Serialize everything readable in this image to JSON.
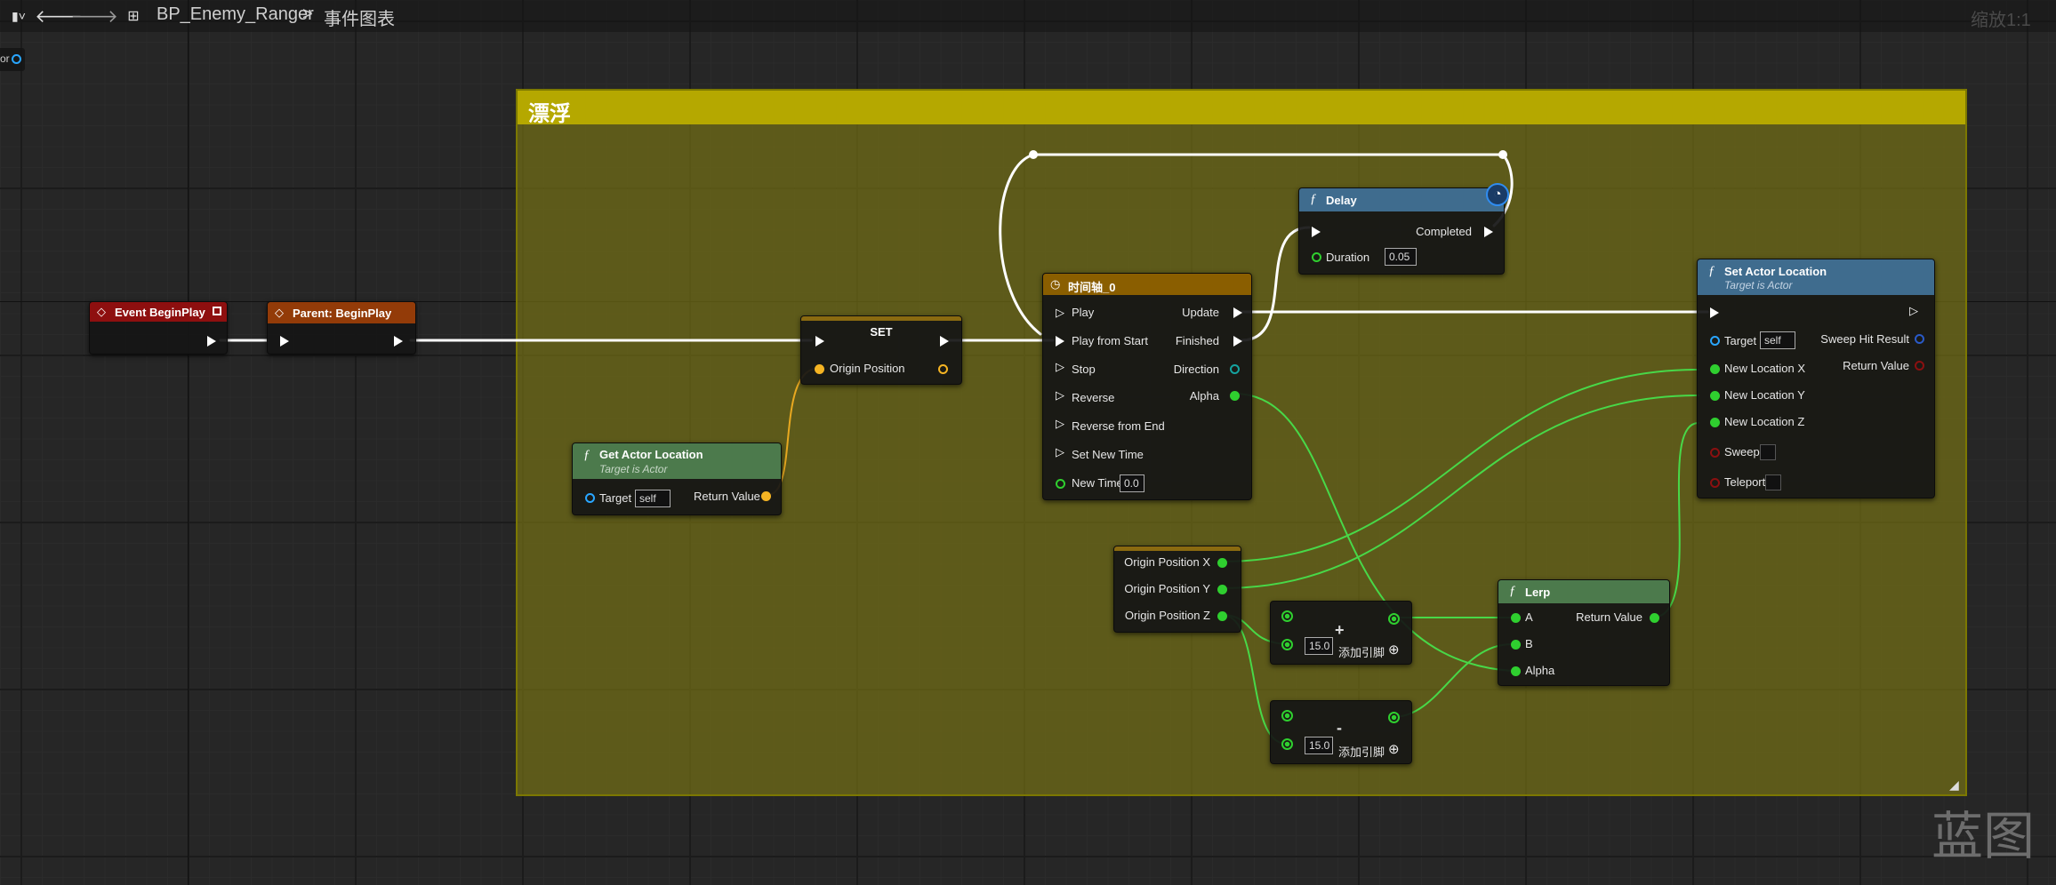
{
  "breadcrumb": {
    "blueprint": "BP_Enemy_Ranger",
    "separator": ">",
    "graph": "事件图表"
  },
  "zoom": "缩放1:1",
  "left_edge_label": "or",
  "watermark": "蓝图",
  "comment": {
    "title": "漂浮"
  },
  "nodes": {
    "event_begin_play": {
      "title": "Event BeginPlay"
    },
    "parent_begin_play": {
      "title": "Parent: BeginPlay"
    },
    "set": {
      "title": "SET",
      "origin_position": "Origin Position"
    },
    "get_actor_location": {
      "title": "Get Actor Location",
      "subtitle": "Target is Actor",
      "target": "Target",
      "target_value": "self",
      "return_value": "Return Value"
    },
    "timeline": {
      "title": "时间轴_0",
      "inputs": [
        "Play",
        "Play from Start",
        "Stop",
        "Reverse",
        "Reverse from End",
        "Set New Time"
      ],
      "new_time": "New Time",
      "new_time_value": "0.0",
      "outputs": [
        "Update",
        "Finished",
        "Direction",
        "Alpha"
      ]
    },
    "delay": {
      "title": "Delay",
      "completed": "Completed",
      "duration": "Duration",
      "duration_value": "0.05"
    },
    "set_actor_location": {
      "title": "Set Actor Location",
      "subtitle": "Target is Actor",
      "target": "Target",
      "target_value": "self",
      "sweep_hit_result": "Sweep Hit Result",
      "return_value": "Return Value",
      "new_location_x": "New Location X",
      "new_location_y": "New Location Y",
      "new_location_z": "New Location Z",
      "sweep": "Sweep",
      "teleport": "Teleport"
    },
    "break_vector": {
      "x": "Origin Position X",
      "y": "Origin Position Y",
      "z": "Origin Position Z"
    },
    "add": {
      "operator": "+",
      "value": "15.0",
      "add_pin": "添加引脚"
    },
    "subtract": {
      "operator": "-",
      "value": "15.0",
      "add_pin": "添加引脚"
    },
    "lerp": {
      "title": "Lerp",
      "a": "A",
      "b": "B",
      "alpha": "Alpha",
      "return_value": "Return Value"
    }
  },
  "colors": {
    "event_header": "#8e0f0f",
    "parent_header": "#933b08",
    "function_header": "#3f6c8e",
    "pure_function_header": "#4c7a4c",
    "timeline_header": "#8a5e00",
    "comment_header": "#b5a800",
    "float_pin": "#2fcf2f",
    "vector_pin": "#f5b423",
    "object_pin": "#29a6ff"
  }
}
